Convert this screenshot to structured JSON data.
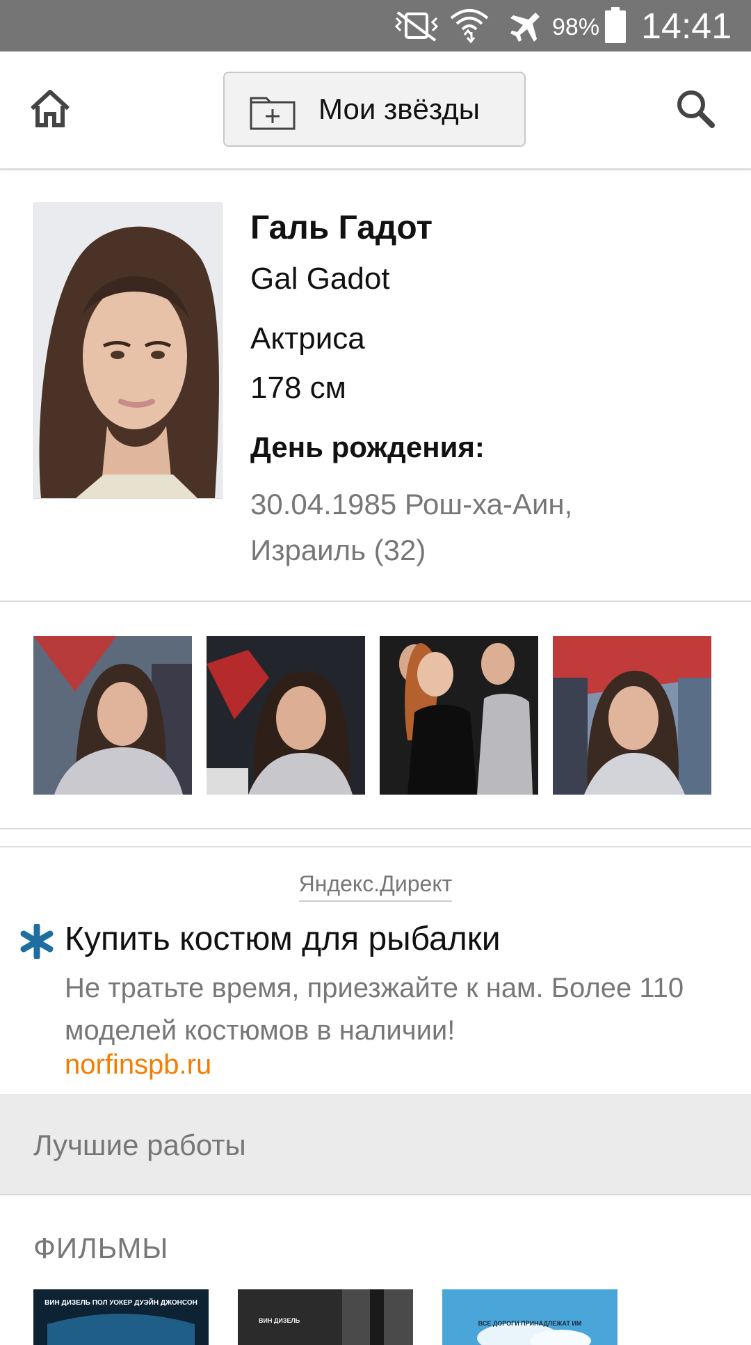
{
  "status_bar": {
    "battery": "98%",
    "time": "14:41",
    "icons": [
      "vibrate-off-icon",
      "wifi-icon",
      "airplane-icon",
      "battery-icon"
    ]
  },
  "header": {
    "my_stars_label": "Мои звёзды",
    "icons": [
      "home-icon",
      "folder-add-icon",
      "search-icon"
    ]
  },
  "profile": {
    "name_ru": "Галь Гадот",
    "name_en": "Gal Gadot",
    "profession": "Актриса",
    "height": "178 см",
    "birthday_label": "День рождения:",
    "birthday_value": "30.04.1985 Рош-ха-Аин, Израиль (32)"
  },
  "photos": [
    "photo-1",
    "photo-2",
    "photo-3",
    "photo-4"
  ],
  "ad": {
    "source": "Яндекс.Директ",
    "title": "Купить костюм для рыбалки",
    "text": "Не тратьте время, приезжайте к нам. Более 110 моделей костюмов в наличии!",
    "link": "norfinspb.ru",
    "link_color": "#f57c00"
  },
  "best_works": {
    "label": "Лучшие работы",
    "films_label": "ФИЛЬМЫ",
    "poster_texts": [
      "ВИН ДИЗЕЛЬ   ПОЛ УОКЕР   ДУЭЙН ДЖОНСОН",
      "ВИН ДИЗЕЛЬ",
      "ВСЕ ДОРОГИ ПРИНАДЛЕЖАТ ИМ"
    ]
  }
}
